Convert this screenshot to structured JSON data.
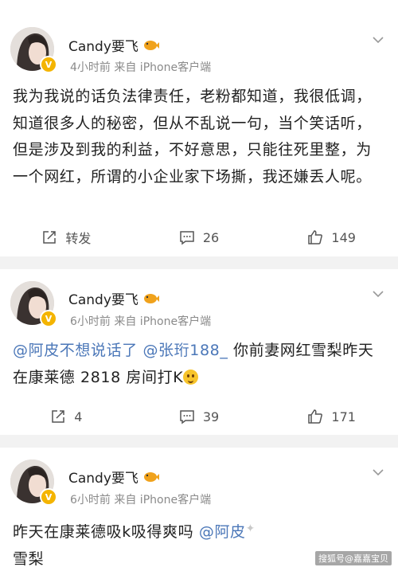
{
  "posts": [
    {
      "user": "Candy要飞",
      "meta": "4小时前  来自 iPhone客户端",
      "text_parts": [
        {
          "type": "text",
          "value": "我为我说的话负法律责任，老粉都知道，我很低调，知道很多人的秘密，但从不乱说一句，当个笑话听，但是涉及到我的利益，不好意思，只能往死里整，为一个网红，所谓的小企业家下场撕，我还嫌丢人呢。"
        }
      ],
      "repost_label": "转发",
      "comments": "26",
      "likes": "149"
    },
    {
      "user": "Candy要飞",
      "meta": "6小时前  来自 iPhone客户端",
      "text_parts": [
        {
          "type": "mention",
          "value": "@阿皮不想说话了"
        },
        {
          "type": "text",
          "value": " "
        },
        {
          "type": "mention",
          "value": "@张珩188_"
        },
        {
          "type": "text",
          "value": " 你前妻网红雪梨昨天在康莱德 2818 房间打K"
        }
      ],
      "reposts": "4",
      "comments": "39",
      "likes": "171"
    },
    {
      "user": "Candy要飞",
      "meta": "6小时前  来自 iPhone客户端",
      "text_parts": [
        {
          "type": "text",
          "value": "昨天在康莱德吸k吸得爽吗 "
        },
        {
          "type": "mention",
          "value": "@阿皮"
        },
        {
          "type": "text",
          "value": "雪梨"
        }
      ]
    }
  ],
  "watermark": "搜狐号@嘉嘉宝贝",
  "colors": {
    "mention": "#4b77b8",
    "meta": "#8a8a8a",
    "badge": "#f4b400"
  }
}
